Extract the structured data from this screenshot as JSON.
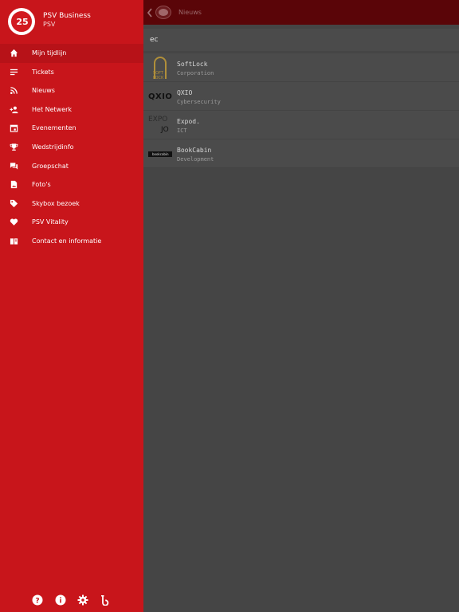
{
  "profile": {
    "badge_number": "25",
    "name": "PSV Business",
    "org": "PSV"
  },
  "menu": {
    "items": [
      {
        "label": "Mijn tijdlijn",
        "icon": "home-icon"
      },
      {
        "label": "Tickets",
        "icon": "list-icon"
      },
      {
        "label": "Nieuws",
        "icon": "rss-icon"
      },
      {
        "label": "Het Netwerk",
        "icon": "person-add-icon"
      },
      {
        "label": "Evenementen",
        "icon": "calendar-icon"
      },
      {
        "label": "Wedstrijdinfo",
        "icon": "trophy-icon"
      },
      {
        "label": "Groepschat",
        "icon": "chat-icon"
      },
      {
        "label": "Foto's",
        "icon": "photo-icon"
      },
      {
        "label": "Skybox bezoek",
        "icon": "tag-icon"
      },
      {
        "label": "PSV Vitality",
        "icon": "heart-icon"
      },
      {
        "label": "Contact en informatie",
        "icon": "book-icon"
      }
    ],
    "active_index": 0
  },
  "footer": {
    "icons": [
      "help-icon",
      "info-icon",
      "settings-icon",
      "brand-icon"
    ]
  },
  "topbar": {
    "title": "Nieuws"
  },
  "search": {
    "value": "ec"
  },
  "results": [
    {
      "name": "SoftLock",
      "sub": "Corporation",
      "logo_text": "SOFT LOCK"
    },
    {
      "name": "QXIO",
      "sub": "Cybersecurity",
      "logo_text": "QXIO"
    },
    {
      "name": "Expod.",
      "sub": "ICT",
      "logo_text_1": "EXPO",
      "logo_text_2": "JO"
    },
    {
      "name": "BookCabin",
      "sub": "Development",
      "logo_text": "bookcabin"
    }
  ],
  "colors": {
    "sidebar": "#c8151b",
    "topbar": "#5a0508",
    "content_bg": "#454545"
  }
}
